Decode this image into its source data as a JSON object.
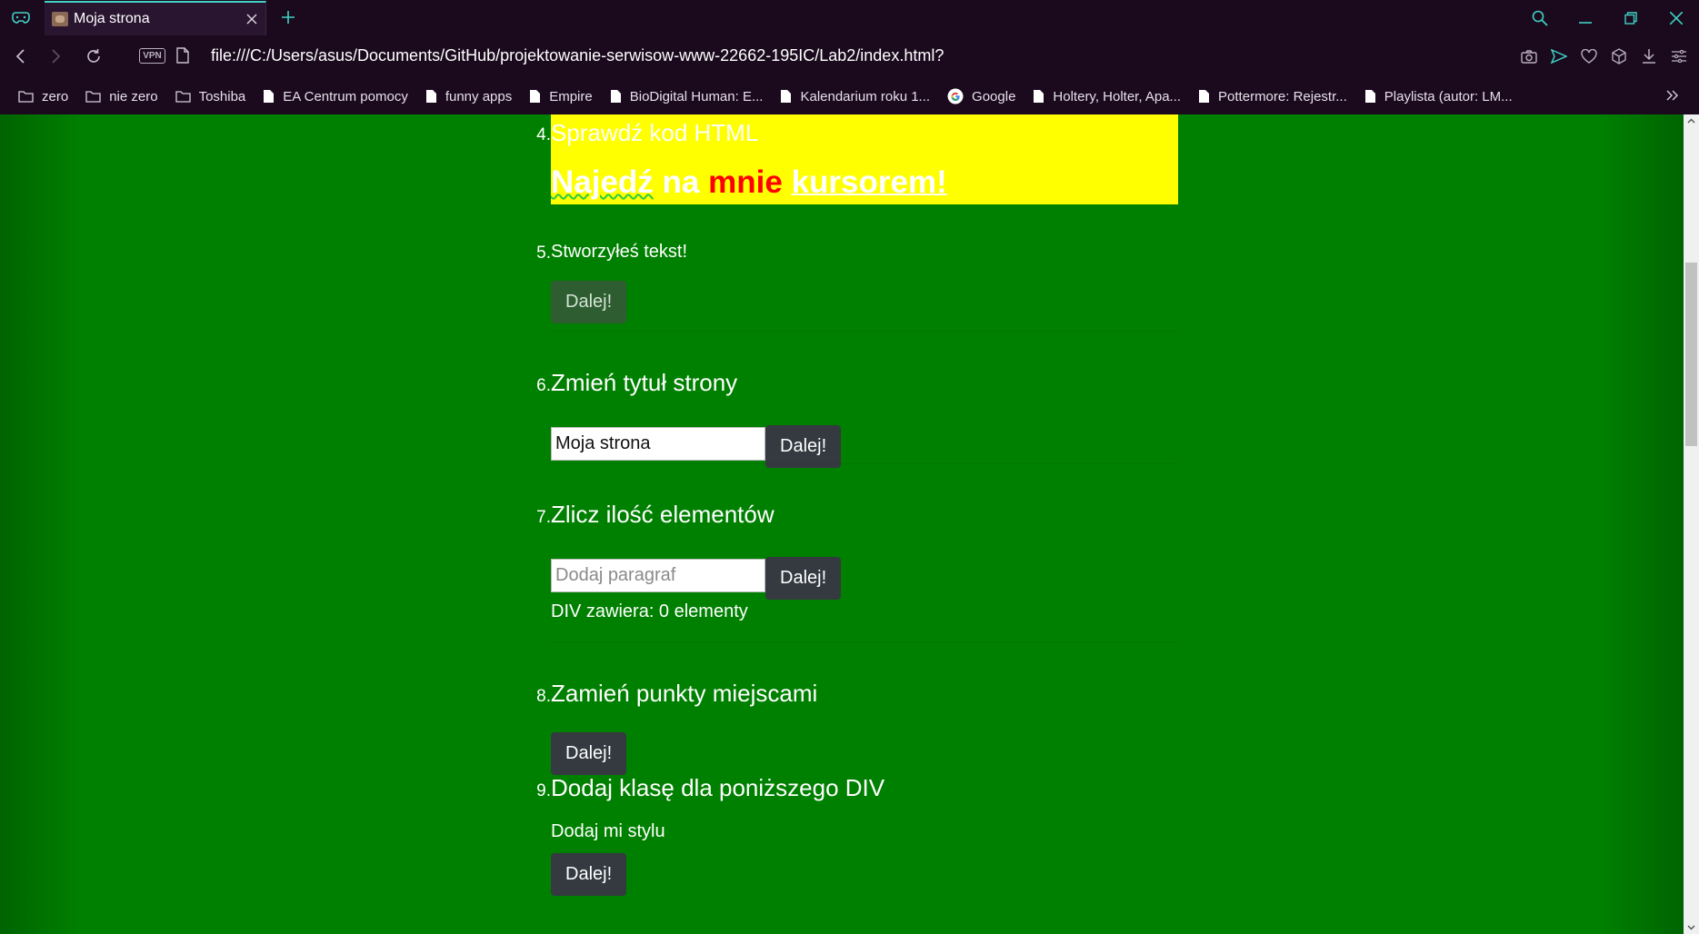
{
  "browser": {
    "tab_title": "Moja strona",
    "url": "file:///C:/Users/asus/Documents/GitHub/projektowanie-serwisow-www-22662-195IC/Lab2/index.html?",
    "vpn_label": "VPN",
    "accent_color": "#3fd1c3",
    "bookmarks": [
      {
        "label": "zero",
        "icon": "folder-icon"
      },
      {
        "label": "nie zero",
        "icon": "folder-icon"
      },
      {
        "label": "Toshiba",
        "icon": "folder-icon"
      },
      {
        "label": "EA Centrum pomocy",
        "icon": "page-icon"
      },
      {
        "label": "funny apps",
        "icon": "page-icon"
      },
      {
        "label": "Empire",
        "icon": "page-icon"
      },
      {
        "label": "BioDigital Human: E...",
        "icon": "page-icon"
      },
      {
        "label": "Kalendarium roku 1...",
        "icon": "page-icon"
      },
      {
        "label": "Google",
        "icon": "google-icon"
      },
      {
        "label": "Holtery, Holter, Apa...",
        "icon": "page-icon"
      },
      {
        "label": "Pottermore: Rejestr...",
        "icon": "page-icon"
      },
      {
        "label": "Playlista (autor: LM...",
        "icon": "page-icon"
      }
    ]
  },
  "page": {
    "background_color": "#008000",
    "item4": {
      "num": "4.",
      "heading": "Sprawdź kod HTML",
      "hover_parts": [
        "Najedź",
        "na",
        "mnie",
        "kursorem!"
      ]
    },
    "item5": {
      "num": "5.",
      "label": "Stworzyłeś tekst!",
      "button": "Dalej!"
    },
    "item6": {
      "num": "6.",
      "heading": "Zmień tytuł strony",
      "input_value": "Moja strona",
      "button": "Dalej!"
    },
    "item7": {
      "num": "7.",
      "heading": "Zlicz ilość elementów",
      "input_placeholder": "Dodaj paragraf",
      "button": "Dalej!",
      "status": "DIV zawiera: 0 elementy"
    },
    "item8": {
      "num": "8.",
      "heading": "Zamień punkty miejscami",
      "button": "Dalej!"
    },
    "item9": {
      "num": "9.",
      "heading": "Dodaj klasę dla poniższego DIV",
      "label": "Dodaj mi stylu",
      "button": "Dalej!"
    }
  }
}
